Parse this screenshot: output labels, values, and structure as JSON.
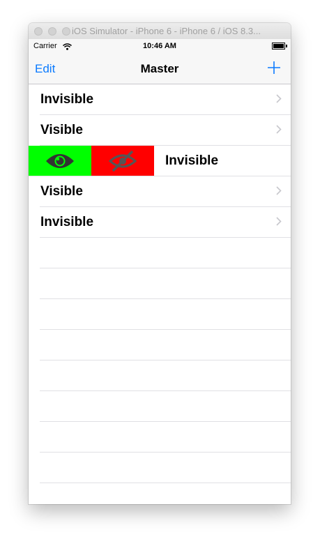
{
  "window": {
    "title": "iOS Simulator - iPhone 6 - iPhone 6 / iOS 8.3..."
  },
  "status_bar": {
    "carrier": "Carrier",
    "time": "10:46 AM"
  },
  "nav": {
    "edit_label": "Edit",
    "title": "Master",
    "add_icon": "plus-icon"
  },
  "rows": [
    {
      "label": "Invisible"
    },
    {
      "label": "Visible"
    },
    {
      "label": "Invisible",
      "swiped": true,
      "actions": [
        {
          "icon": "eye-icon",
          "color": "#00ff00"
        },
        {
          "icon": "eye-slash-icon",
          "color": "#ff0000"
        }
      ]
    },
    {
      "label": "Visible"
    },
    {
      "label": "Invisible"
    }
  ],
  "colors": {
    "tint": "#0a7aff",
    "separator": "#e0e0e4"
  }
}
